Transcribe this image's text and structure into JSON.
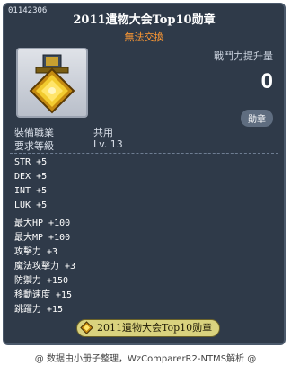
{
  "tooltip": {
    "item_id": "01142306",
    "title": "2011遺物大会Top10勋章",
    "trade_status": "無法交換",
    "power": {
      "label": "戰鬥力提升量",
      "value": "0"
    },
    "category": "勛章",
    "requirements": [
      {
        "label": "裝備職業",
        "value": "共用"
      },
      {
        "label": "要求等級",
        "value": "Lv. 13"
      }
    ],
    "stats": [
      {
        "name": "STR",
        "value": "+5"
      },
      {
        "name": "DEX",
        "value": "+5"
      },
      {
        "name": "INT",
        "value": "+5"
      },
      {
        "name": "LUK",
        "value": "+5"
      },
      {
        "name": "最大HP",
        "value": "+100"
      },
      {
        "name": "最大MP",
        "value": "+100"
      },
      {
        "name": "攻擊力",
        "value": "+3"
      },
      {
        "name": "魔法攻擊力",
        "value": "+3"
      },
      {
        "name": "防禦力",
        "value": "+150"
      },
      {
        "name": "移動速度",
        "value": "+15"
      },
      {
        "name": "跳躍力",
        "value": "+15"
      }
    ],
    "set_name": "2011遺物大会Top10勋章",
    "icon": "gold-medal-icon"
  },
  "footer": "@ 数据由小册子整理，WzComparerR2-NTMS解析 @",
  "colors": {
    "panel_bg": "#2f3a49",
    "trade_status": "#ff9933",
    "badge_gold": "#d9d27e"
  }
}
